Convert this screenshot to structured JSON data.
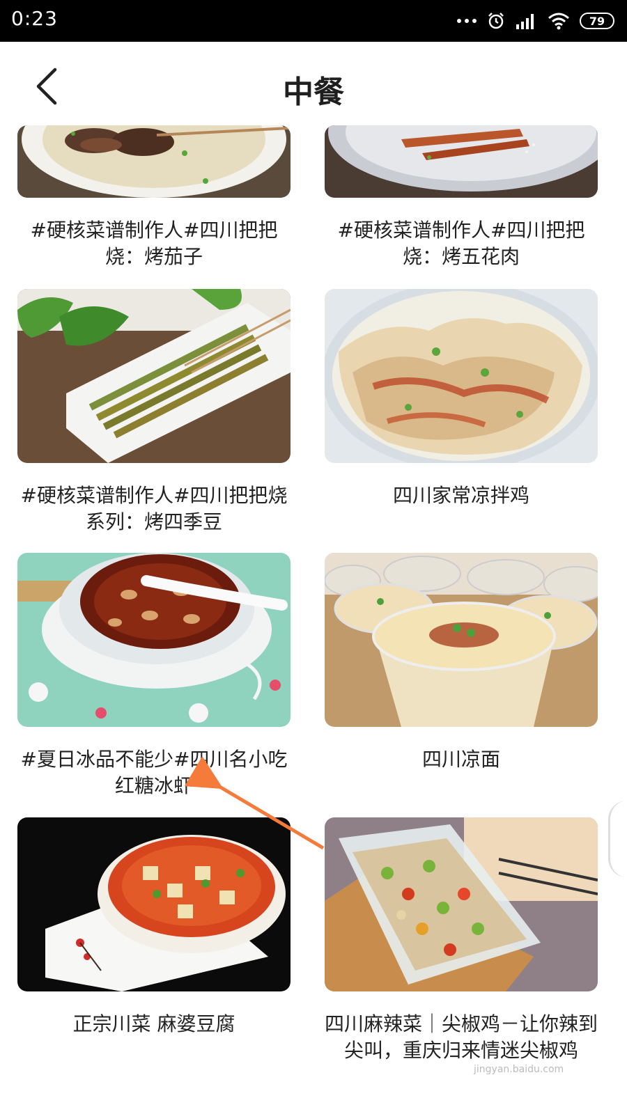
{
  "status_bar": {
    "time": "0:23",
    "battery": "79",
    "icons": [
      "more-dots-icon",
      "alarm-icon",
      "signal-icon",
      "wifi-icon",
      "battery-icon"
    ]
  },
  "header": {
    "title": "中餐",
    "back_icon": "chevron-left-icon"
  },
  "recipes": [
    {
      "title": "#硬核菜谱制作人#四川把把烧：烤茄子"
    },
    {
      "title": "#硬核菜谱制作人#四川把把烧：烤五花肉"
    },
    {
      "title": "#硬核菜谱制作人#四川把把烧系列：烤四季豆"
    },
    {
      "title": "四川家常凉拌鸡"
    },
    {
      "title": "#夏日冰品不能少#四川名小吃红糖冰虾"
    },
    {
      "title": "四川凉面"
    },
    {
      "title": "正宗川菜 麻婆豆腐"
    },
    {
      "title": "四川麻辣菜｜尖椒鸡－让你辣到尖叫，重庆归来情迷尖椒鸡"
    }
  ],
  "annotation": {
    "color": "#f47b3a"
  },
  "watermark": "jingyan.baidu.com"
}
